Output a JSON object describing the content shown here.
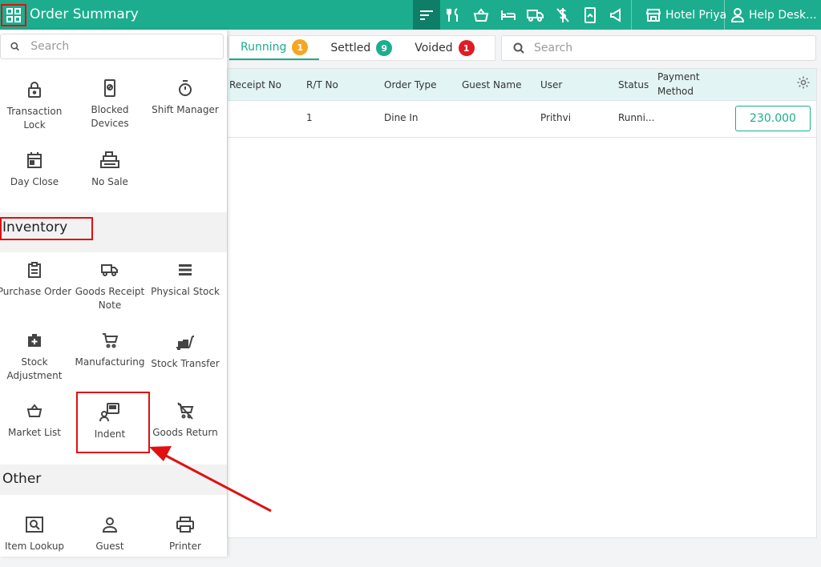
{
  "header": {
    "title": "Order Summary",
    "hotel": "Hotel Priya",
    "help": "Help Desk..."
  },
  "tabs": [
    {
      "label": "Running",
      "count": "1"
    },
    {
      "label": "Settled",
      "count": "9"
    },
    {
      "label": "Voided",
      "count": "1"
    }
  ],
  "search": {
    "drawer_placeholder": "Search",
    "main_placeholder": "Search"
  },
  "table": {
    "columns": [
      "Receipt No",
      "R/T No",
      "Order Type",
      "Guest Name",
      "User",
      "Status",
      "Payment Method"
    ],
    "rows": [
      {
        "receipt_no": "",
        "rt_no": "1",
        "order_type": "Dine In",
        "guest_name": "",
        "user": "Prithvi",
        "status": "Runni...",
        "payment_method": "",
        "amount": "230.000"
      }
    ]
  },
  "drawer": {
    "top_items": [
      {
        "label": "Transaction Lock",
        "icon": "lock-icon"
      },
      {
        "label": "Blocked Devices",
        "icon": "blocked-device-icon"
      },
      {
        "label": "Shift Manager",
        "icon": "stopwatch-icon"
      },
      {
        "label": "Day Close",
        "icon": "calendar-icon"
      },
      {
        "label": "No Sale",
        "icon": "cash-register-icon"
      }
    ],
    "inventory_title": "Inventory",
    "inventory_items": [
      {
        "label": "Purchase Order",
        "icon": "clipboard-icon"
      },
      {
        "label": "Goods Receipt Note",
        "icon": "truck-icon"
      },
      {
        "label": "Physical Stock",
        "icon": "list-icon"
      },
      {
        "label": "Stock Adjustment",
        "icon": "medkit-icon"
      },
      {
        "label": "Manufacturing",
        "icon": "cart-icon"
      },
      {
        "label": "Stock Transfer",
        "icon": "trolley-icon"
      },
      {
        "label": "Market List",
        "icon": "basket-icon"
      },
      {
        "label": "Indent",
        "icon": "indent-icon"
      },
      {
        "label": "Goods Return",
        "icon": "cart-off-icon"
      }
    ],
    "other_title": "Other",
    "other_items": [
      {
        "label": "Item Lookup",
        "icon": "lookup-icon"
      },
      {
        "label": "Guest",
        "icon": "person-icon"
      },
      {
        "label": "Printer",
        "icon": "printer-icon"
      }
    ]
  },
  "colors": {
    "accent": "#1cad8e",
    "highlight": "#e01010"
  }
}
